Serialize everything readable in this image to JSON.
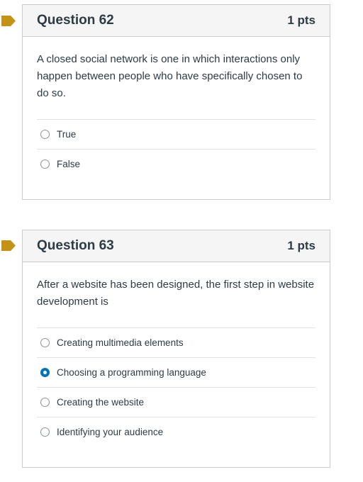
{
  "colors": {
    "flag": "#c49316",
    "accent": "#0374b5",
    "text": "#2d3b45",
    "border": "#c7cdd1"
  },
  "questions": [
    {
      "title": "Question 62",
      "points": "1 pts",
      "text": "A closed social network is one in which interactions only happen between people who have specifically chosen to do so.",
      "answers": [
        {
          "label": "True",
          "selected": false
        },
        {
          "label": "False",
          "selected": false
        }
      ]
    },
    {
      "title": "Question 63",
      "points": "1 pts",
      "text": "After a website has been designed, the first step in website development is",
      "answers": [
        {
          "label": "Creating multimedia elements",
          "selected": false
        },
        {
          "label": "Choosing a programming language",
          "selected": true
        },
        {
          "label": "Creating the website",
          "selected": false
        },
        {
          "label": "Identifying your audience",
          "selected": false
        }
      ]
    }
  ]
}
